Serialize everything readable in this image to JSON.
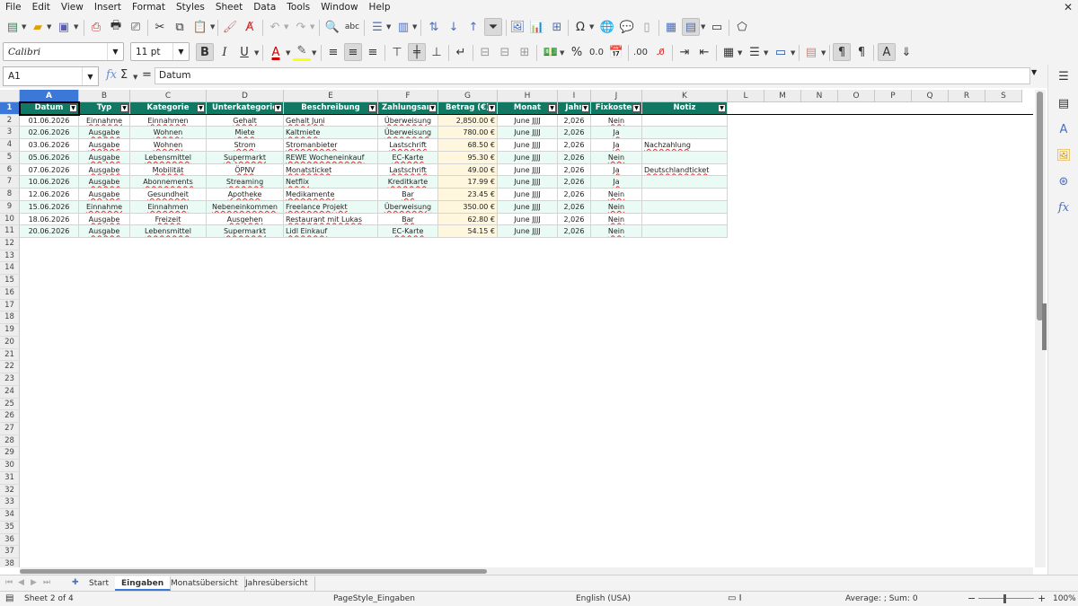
{
  "menu": [
    "File",
    "Edit",
    "View",
    "Insert",
    "Format",
    "Styles",
    "Sheet",
    "Data",
    "Tools",
    "Window",
    "Help"
  ],
  "toolbar": {
    "font_name": "Calibri",
    "font_size": "11 pt"
  },
  "formula_bar": {
    "cell_ref": "A1",
    "content": "Datum"
  },
  "columns": [
    "A",
    "B",
    "C",
    "D",
    "E",
    "F",
    "G",
    "H",
    "I",
    "J",
    "K",
    "L",
    "M",
    "N",
    "O",
    "P",
    "Q",
    "R",
    "S"
  ],
  "table": {
    "headers": [
      "Datum",
      "Typ",
      "Kategorie",
      "Unterkategorie",
      "Beschreibung",
      "Zahlungsart",
      "Betrag (€)",
      "Monat",
      "Jahr",
      "Fixkosten",
      "Notiz"
    ],
    "rows": [
      [
        "01.06.2026",
        "Einnahme",
        "Einnahmen",
        "Gehalt",
        "Gehalt Juni",
        "Überweisung",
        "2,850.00 €",
        "June JJJJ",
        "2,026",
        "Nein",
        ""
      ],
      [
        "02.06.2026",
        "Ausgabe",
        "Wohnen",
        "Miete",
        "Kaltmiete",
        "Überweisung",
        "780.00 €",
        "June JJJJ",
        "2,026",
        "Ja",
        ""
      ],
      [
        "03.06.2026",
        "Ausgabe",
        "Wohnen",
        "Strom",
        "Stromanbieter",
        "Lastschrift",
        "68.50 €",
        "June JJJJ",
        "2,026",
        "Ja",
        "Nachzahlung"
      ],
      [
        "05.06.2026",
        "Ausgabe",
        "Lebensmittel",
        "Supermarkt",
        "REWE Wocheneinkauf",
        "EC-Karte",
        "95.30 €",
        "June JJJJ",
        "2,026",
        "Nein",
        ""
      ],
      [
        "07.06.2026",
        "Ausgabe",
        "Mobilität",
        "ÖPNV",
        "Monatsticket",
        "Lastschrift",
        "49.00 €",
        "June JJJJ",
        "2,026",
        "Ja",
        "Deutschlandticket"
      ],
      [
        "10.06.2026",
        "Ausgabe",
        "Abonnements",
        "Streaming",
        "Netflix",
        "Kreditkarte",
        "17.99 €",
        "June JJJJ",
        "2,026",
        "Ja",
        ""
      ],
      [
        "12.06.2026",
        "Ausgabe",
        "Gesundheit",
        "Apotheke",
        "Medikamente",
        "Bar",
        "23.45 €",
        "June JJJJ",
        "2,026",
        "Nein",
        ""
      ],
      [
        "15.06.2026",
        "Einnahme",
        "Einnahmen",
        "Nebeneinkommen",
        "Freelance Projekt",
        "Überweisung",
        "350.00 €",
        "June JJJJ",
        "2,026",
        "Nein",
        ""
      ],
      [
        "18.06.2026",
        "Ausgabe",
        "Freizeit",
        "Ausgehen",
        "Restaurant mit Lukas",
        "Bar",
        "62.80 €",
        "June JJJJ",
        "2,026",
        "Nein",
        ""
      ],
      [
        "20.06.2026",
        "Ausgabe",
        "Lebensmittel",
        "Supermarkt",
        "Lidl Einkauf",
        "EC-Karte",
        "54.15 €",
        "June JJJJ",
        "2,026",
        "Nein",
        ""
      ]
    ]
  },
  "row_numbers": [
    "1",
    "2",
    "3",
    "4",
    "5",
    "6",
    "7",
    "8",
    "9",
    "10",
    "11",
    "12",
    "13",
    "14",
    "15",
    "16",
    "17",
    "18",
    "19",
    "20",
    "21",
    "22",
    "23",
    "24",
    "25",
    "26",
    "27",
    "28",
    "29",
    "30",
    "31",
    "32",
    "33",
    "34",
    "35",
    "36",
    "37",
    "38"
  ],
  "sheet_tabs": [
    "Start",
    "Eingaben",
    "Monatsübersicht",
    "Jahresübersicht"
  ],
  "active_tab": "Eingaben",
  "status": {
    "sheet": "Sheet 2 of 4",
    "page_style": "PageStyle_Eingaben",
    "language": "English (USA)",
    "sum": "Average: ; Sum: 0",
    "zoom": "100%"
  },
  "colors": {
    "header_fill": "#117864",
    "selection": "#3c78d8",
    "amount_fill": "#fff7dd",
    "alt_row_fill": "#eafaf5"
  }
}
